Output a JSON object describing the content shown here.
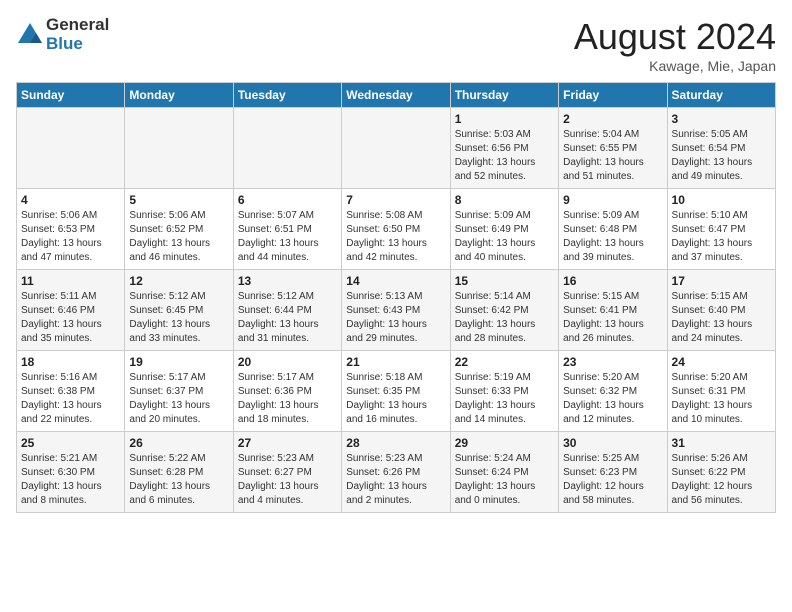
{
  "header": {
    "logo_general": "General",
    "logo_blue": "Blue",
    "month_title": "August 2024",
    "location": "Kawage, Mie, Japan"
  },
  "days_of_week": [
    "Sunday",
    "Monday",
    "Tuesday",
    "Wednesday",
    "Thursday",
    "Friday",
    "Saturday"
  ],
  "weeks": [
    [
      {
        "day": "",
        "info": ""
      },
      {
        "day": "",
        "info": ""
      },
      {
        "day": "",
        "info": ""
      },
      {
        "day": "",
        "info": ""
      },
      {
        "day": "1",
        "info": "Sunrise: 5:03 AM\nSunset: 6:56 PM\nDaylight: 13 hours\nand 52 minutes."
      },
      {
        "day": "2",
        "info": "Sunrise: 5:04 AM\nSunset: 6:55 PM\nDaylight: 13 hours\nand 51 minutes."
      },
      {
        "day": "3",
        "info": "Sunrise: 5:05 AM\nSunset: 6:54 PM\nDaylight: 13 hours\nand 49 minutes."
      }
    ],
    [
      {
        "day": "4",
        "info": "Sunrise: 5:06 AM\nSunset: 6:53 PM\nDaylight: 13 hours\nand 47 minutes."
      },
      {
        "day": "5",
        "info": "Sunrise: 5:06 AM\nSunset: 6:52 PM\nDaylight: 13 hours\nand 46 minutes."
      },
      {
        "day": "6",
        "info": "Sunrise: 5:07 AM\nSunset: 6:51 PM\nDaylight: 13 hours\nand 44 minutes."
      },
      {
        "day": "7",
        "info": "Sunrise: 5:08 AM\nSunset: 6:50 PM\nDaylight: 13 hours\nand 42 minutes."
      },
      {
        "day": "8",
        "info": "Sunrise: 5:09 AM\nSunset: 6:49 PM\nDaylight: 13 hours\nand 40 minutes."
      },
      {
        "day": "9",
        "info": "Sunrise: 5:09 AM\nSunset: 6:48 PM\nDaylight: 13 hours\nand 39 minutes."
      },
      {
        "day": "10",
        "info": "Sunrise: 5:10 AM\nSunset: 6:47 PM\nDaylight: 13 hours\nand 37 minutes."
      }
    ],
    [
      {
        "day": "11",
        "info": "Sunrise: 5:11 AM\nSunset: 6:46 PM\nDaylight: 13 hours\nand 35 minutes."
      },
      {
        "day": "12",
        "info": "Sunrise: 5:12 AM\nSunset: 6:45 PM\nDaylight: 13 hours\nand 33 minutes."
      },
      {
        "day": "13",
        "info": "Sunrise: 5:12 AM\nSunset: 6:44 PM\nDaylight: 13 hours\nand 31 minutes."
      },
      {
        "day": "14",
        "info": "Sunrise: 5:13 AM\nSunset: 6:43 PM\nDaylight: 13 hours\nand 29 minutes."
      },
      {
        "day": "15",
        "info": "Sunrise: 5:14 AM\nSunset: 6:42 PM\nDaylight: 13 hours\nand 28 minutes."
      },
      {
        "day": "16",
        "info": "Sunrise: 5:15 AM\nSunset: 6:41 PM\nDaylight: 13 hours\nand 26 minutes."
      },
      {
        "day": "17",
        "info": "Sunrise: 5:15 AM\nSunset: 6:40 PM\nDaylight: 13 hours\nand 24 minutes."
      }
    ],
    [
      {
        "day": "18",
        "info": "Sunrise: 5:16 AM\nSunset: 6:38 PM\nDaylight: 13 hours\nand 22 minutes."
      },
      {
        "day": "19",
        "info": "Sunrise: 5:17 AM\nSunset: 6:37 PM\nDaylight: 13 hours\nand 20 minutes."
      },
      {
        "day": "20",
        "info": "Sunrise: 5:17 AM\nSunset: 6:36 PM\nDaylight: 13 hours\nand 18 minutes."
      },
      {
        "day": "21",
        "info": "Sunrise: 5:18 AM\nSunset: 6:35 PM\nDaylight: 13 hours\nand 16 minutes."
      },
      {
        "day": "22",
        "info": "Sunrise: 5:19 AM\nSunset: 6:33 PM\nDaylight: 13 hours\nand 14 minutes."
      },
      {
        "day": "23",
        "info": "Sunrise: 5:20 AM\nSunset: 6:32 PM\nDaylight: 13 hours\nand 12 minutes."
      },
      {
        "day": "24",
        "info": "Sunrise: 5:20 AM\nSunset: 6:31 PM\nDaylight: 13 hours\nand 10 minutes."
      }
    ],
    [
      {
        "day": "25",
        "info": "Sunrise: 5:21 AM\nSunset: 6:30 PM\nDaylight: 13 hours\nand 8 minutes."
      },
      {
        "day": "26",
        "info": "Sunrise: 5:22 AM\nSunset: 6:28 PM\nDaylight: 13 hours\nand 6 minutes."
      },
      {
        "day": "27",
        "info": "Sunrise: 5:23 AM\nSunset: 6:27 PM\nDaylight: 13 hours\nand 4 minutes."
      },
      {
        "day": "28",
        "info": "Sunrise: 5:23 AM\nSunset: 6:26 PM\nDaylight: 13 hours\nand 2 minutes."
      },
      {
        "day": "29",
        "info": "Sunrise: 5:24 AM\nSunset: 6:24 PM\nDaylight: 13 hours\nand 0 minutes."
      },
      {
        "day": "30",
        "info": "Sunrise: 5:25 AM\nSunset: 6:23 PM\nDaylight: 12 hours\nand 58 minutes."
      },
      {
        "day": "31",
        "info": "Sunrise: 5:26 AM\nSunset: 6:22 PM\nDaylight: 12 hours\nand 56 minutes."
      }
    ]
  ]
}
